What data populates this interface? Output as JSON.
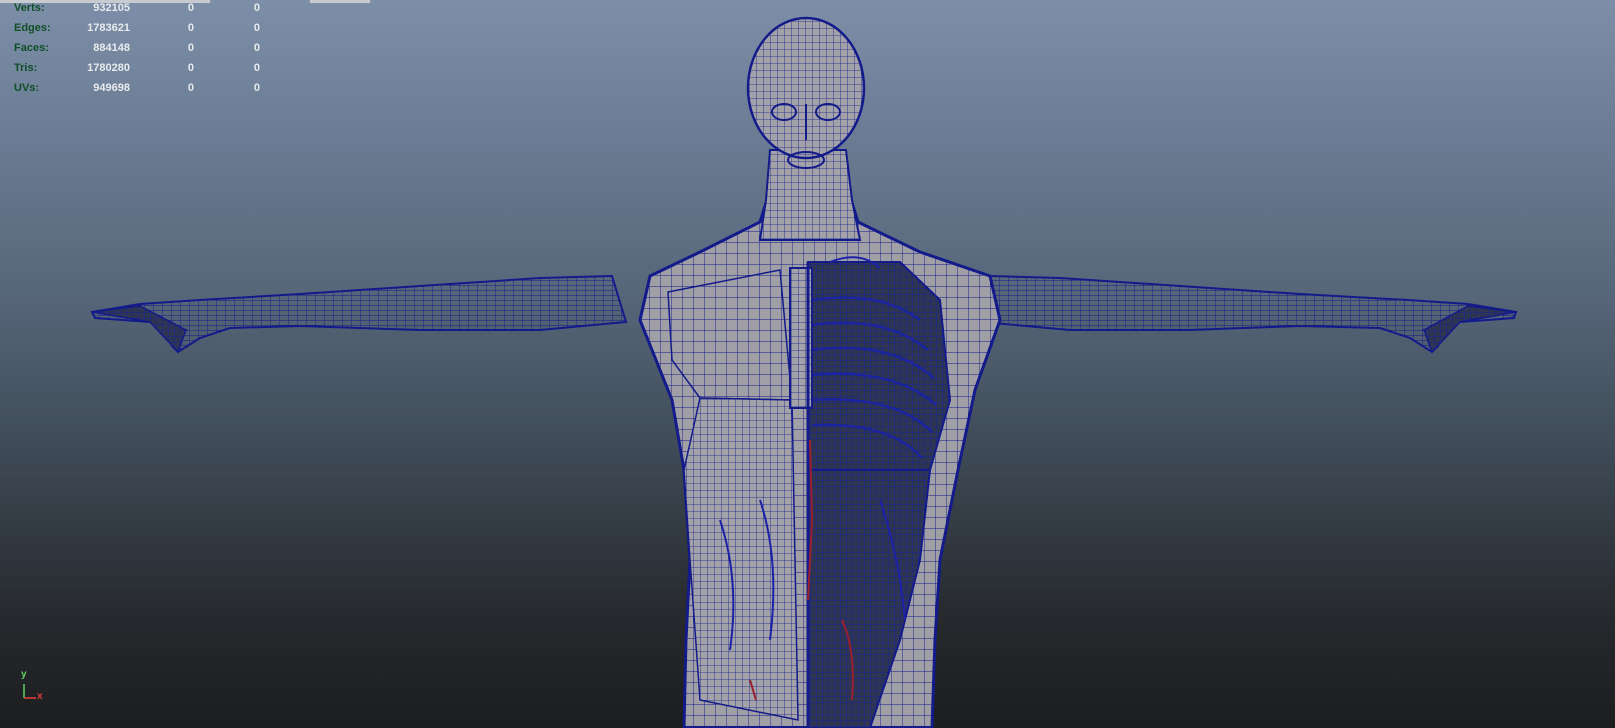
{
  "viewport": {
    "background_top": "#7d8fa8",
    "background_bottom": "#1c1d1f",
    "wire_color": "#131a8a",
    "shade_color": "#9a9a9e",
    "organ_color": "#9b1f2e"
  },
  "hud": {
    "label_color": "#0f4f27",
    "value_color": "#e8eaee",
    "rows": [
      {
        "label": "Verts:",
        "value": "932105",
        "sel": "0",
        "uv": "0"
      },
      {
        "label": "Edges:",
        "value": "1783621",
        "sel": "0",
        "uv": "0"
      },
      {
        "label": "Faces:",
        "value": "884148",
        "sel": "0",
        "uv": "0"
      },
      {
        "label": "Tris:",
        "value": "1780280",
        "sel": "0",
        "uv": "0"
      },
      {
        "label": "UVs:",
        "value": "949698",
        "sel": "0",
        "uv": "0"
      }
    ]
  },
  "axis": {
    "y_label": "y",
    "x_label": "x",
    "y_color": "#5fd35f",
    "x_color": "#e04040"
  }
}
